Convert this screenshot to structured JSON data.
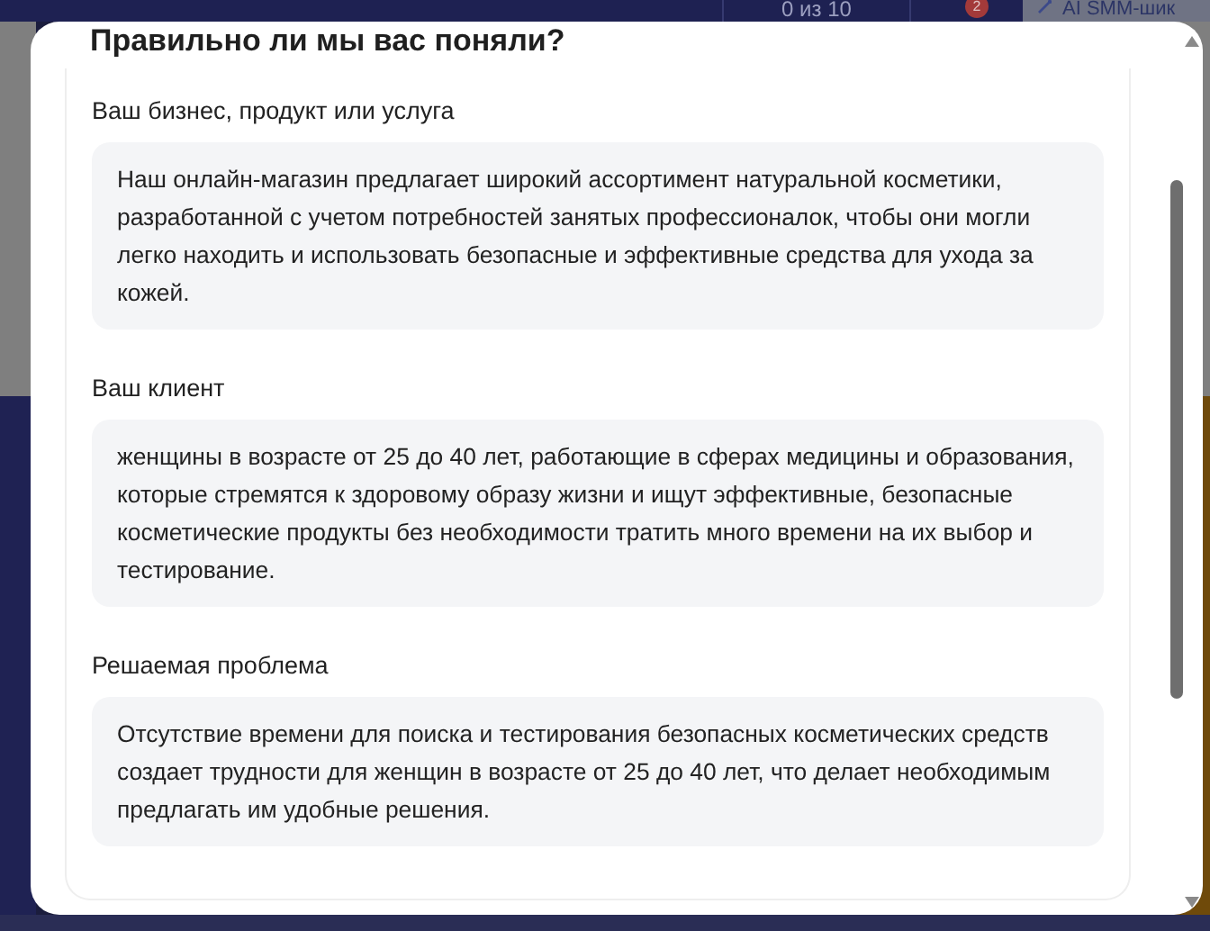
{
  "top_bar": {
    "counter": "0 из 10",
    "notification_badge": "2",
    "button": "AI SMM-шик"
  },
  "dialog": {
    "title": "Правильно ли мы вас поняли?",
    "sections": [
      {
        "label": "Ваш бизнес, продукт или услуга",
        "text": "Наш онлайн-магазин предлагает широкий ассортимент натуральной косметики, разработанной с учетом потребностей занятых профессионалок, чтобы они могли легко находить и использовать безопасные и эффективные средства для ухода за кожей."
      },
      {
        "label": "Ваш клиент",
        "text": "женщины в возрасте от 25 до 40 лет, работающие в сферах медицины и образования, которые стремятся к здоровому образу жизни и ищут эффективные, безопасные косметические продукты без необходимости тратить много времени на их выбор и тестирование."
      },
      {
        "label": "Решаемая проблема",
        "text": "Отсутствие времени для поиска и тестирования безопасных косметических средств создает трудности для женщин в возрасте от 25 до 40 лет, что делает необходимым предлагать им удобные решения."
      }
    ]
  }
}
